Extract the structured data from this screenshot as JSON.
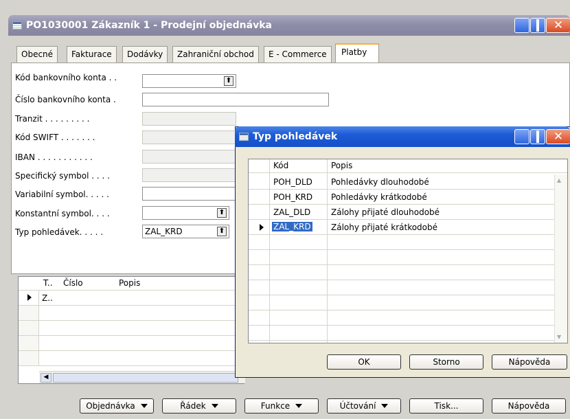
{
  "main_window": {
    "title": "PO1030001 Zákazník 1 - Prodejní objednávka",
    "tabs": [
      "Obecné",
      "Fakturace",
      "Dodávky",
      "Zahraniční obchod",
      "E - Commerce",
      "Platby"
    ],
    "fields": [
      {
        "label": "Kód bankovního konta . .",
        "value": ""
      },
      {
        "label": "Číslo bankovního konta .",
        "value": ""
      },
      {
        "label": "Tranzit . . . . . . . . .",
        "value": ""
      },
      {
        "label": "Kód SWIFT . . . . . . .",
        "value": ""
      },
      {
        "label": "IBAN . . . . . . . . . . .",
        "value": ""
      },
      {
        "label": "Specifický symbol . . . .",
        "value": ""
      },
      {
        "label": "Variabilní symbol. . . . .",
        "value": ""
      },
      {
        "label": "Konstantní symbol. . . .",
        "value": ""
      },
      {
        "label": "Typ pohledávek. . . . .",
        "value": "ZAL_KRD"
      }
    ],
    "lines": {
      "headers": [
        "T..",
        "Číslo",
        "Popis"
      ],
      "rows": [
        {
          "t": "Z..",
          "cislo": "",
          "popis": ""
        }
      ]
    },
    "buttons": [
      "Objednávka",
      "Řádek",
      "Funkce",
      "Účtování",
      "Tisk...",
      "Nápověda"
    ]
  },
  "dialog": {
    "title": "Typ pohledávek",
    "headers": [
      "Kód",
      "Popis"
    ],
    "rows": [
      {
        "kod": "POH_DLD",
        "popis": "Pohledávky dlouhodobé"
      },
      {
        "kod": "POH_KRD",
        "popis": "Pohledávky krátkodobé"
      },
      {
        "kod": "ZAL_DLD",
        "popis": "Zálohy přijaté dlouhodobé"
      },
      {
        "kod": "ZAL_KRD",
        "popis": "Zálohy přijaté krátkodobé"
      }
    ],
    "buttons": [
      "OK",
      "Storno",
      "Nápověda"
    ]
  },
  "colors": {
    "title_active": "#1d5bd7",
    "title_inactive": "#8e8ea8",
    "selection": "#316ac5"
  }
}
